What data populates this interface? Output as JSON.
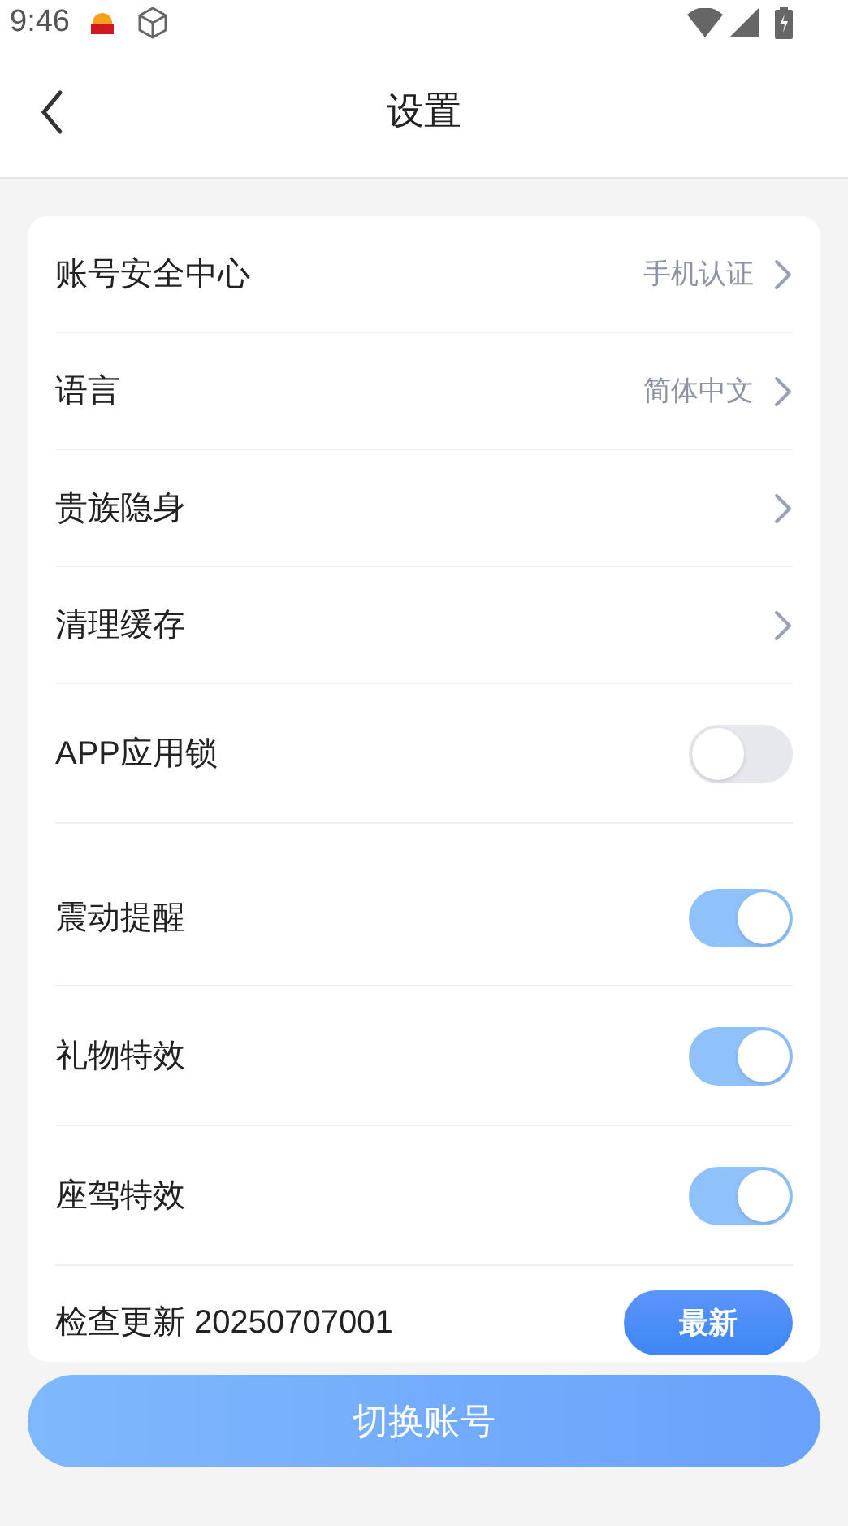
{
  "status_bar": {
    "time": "9:46"
  },
  "header": {
    "title": "设置"
  },
  "settings": [
    {
      "kind": "link",
      "label": "账号安全中心",
      "value": "手机认证"
    },
    {
      "kind": "link",
      "label": "语言",
      "value": "简体中文"
    },
    {
      "kind": "link",
      "label": "贵族隐身"
    },
    {
      "kind": "link",
      "label": "清理缓存"
    },
    {
      "kind": "toggle",
      "label": "APP应用锁",
      "on": false
    },
    {
      "kind": "toggle",
      "label": "震动提醒",
      "on": true
    },
    {
      "kind": "toggle",
      "label": "礼物特效",
      "on": true
    },
    {
      "kind": "toggle",
      "label": "座驾特效",
      "on": true
    },
    {
      "kind": "update",
      "label": "检查更新 20250707001",
      "badge": "最新"
    }
  ],
  "switch_account_button": "切换账号"
}
